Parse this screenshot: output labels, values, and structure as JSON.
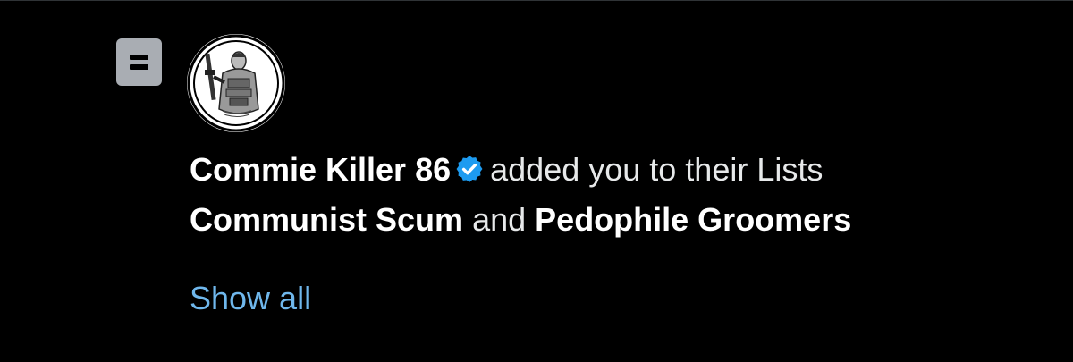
{
  "notification": {
    "user_name": "Commie Killer 86",
    "action_text": "added you to their Lists",
    "list_one": "Communist Scum",
    "conjunction": "and",
    "list_two": "Pedophile Groomers",
    "show_all_label": "Show all"
  },
  "icons": {
    "type_icon": "list-icon",
    "verified": "verified-badge-icon",
    "avatar": "avatar-image"
  },
  "colors": {
    "background": "#000000",
    "text": "#e7e9ea",
    "link": "#6fb7ec",
    "verified": "#1d9bf0",
    "icon_bg": "#a9adb3"
  }
}
